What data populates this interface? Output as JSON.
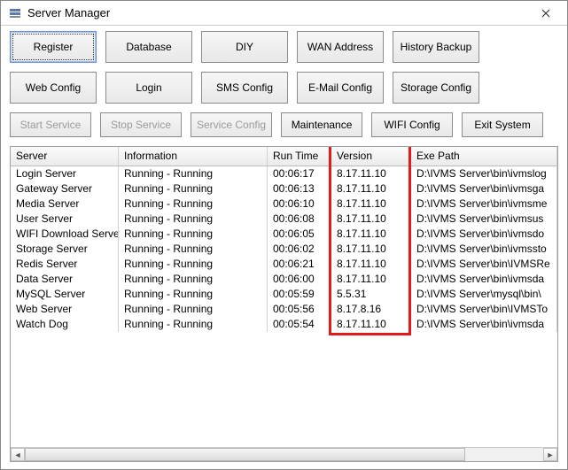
{
  "window": {
    "title": "Server Manager",
    "icon": "server-manager-icon"
  },
  "toolbar_rows": [
    [
      {
        "key": "register",
        "label": "Register",
        "focused": true,
        "disabled": false
      },
      {
        "key": "database",
        "label": "Database",
        "focused": false,
        "disabled": false
      },
      {
        "key": "diy",
        "label": "DIY",
        "focused": false,
        "disabled": false
      },
      {
        "key": "wan",
        "label": "WAN Address",
        "focused": false,
        "disabled": false
      },
      {
        "key": "history",
        "label": "History Backup",
        "focused": false,
        "disabled": false
      }
    ],
    [
      {
        "key": "webconfig",
        "label": "Web Config",
        "focused": false,
        "disabled": false
      },
      {
        "key": "login",
        "label": "Login",
        "focused": false,
        "disabled": false
      },
      {
        "key": "smsconfig",
        "label": "SMS Config",
        "focused": false,
        "disabled": false
      },
      {
        "key": "emailconfig",
        "label": "E-Mail Config",
        "focused": false,
        "disabled": false
      },
      {
        "key": "storageconfig",
        "label": "Storage Config",
        "focused": false,
        "disabled": false
      }
    ],
    [
      {
        "key": "startservice",
        "label": "Start Service",
        "focused": false,
        "disabled": true,
        "short": true
      },
      {
        "key": "stopservice",
        "label": "Stop Service",
        "focused": false,
        "disabled": true,
        "short": true
      },
      {
        "key": "serviceconfig",
        "label": "Service Config",
        "focused": false,
        "disabled": true,
        "short": true
      },
      {
        "key": "maintenance",
        "label": "Maintenance",
        "focused": false,
        "disabled": false,
        "short": true
      },
      {
        "key": "wificonfig",
        "label": "WIFI Config",
        "focused": false,
        "disabled": false,
        "short": true
      },
      {
        "key": "exitsystem",
        "label": "Exit System",
        "focused": false,
        "disabled": false,
        "short": true
      }
    ]
  ],
  "columns": [
    {
      "key": "server",
      "label": "Server"
    },
    {
      "key": "info",
      "label": "Information"
    },
    {
      "key": "run",
      "label": "Run Time"
    },
    {
      "key": "ver",
      "label": "Version"
    },
    {
      "key": "path",
      "label": "Exe Path"
    }
  ],
  "rows": [
    {
      "server": "Login Server",
      "info": "Running - Running",
      "run": "00:06:17",
      "ver": "8.17.11.10",
      "path": "D:\\IVMS Server\\bin\\ivmslog"
    },
    {
      "server": "Gateway Server",
      "info": "Running - Running",
      "run": "00:06:13",
      "ver": "8.17.11.10",
      "path": "D:\\IVMS Server\\bin\\ivmsga"
    },
    {
      "server": "Media Server",
      "info": "Running - Running",
      "run": "00:06:10",
      "ver": "8.17.11.10",
      "path": "D:\\IVMS Server\\bin\\ivmsme"
    },
    {
      "server": "User Server",
      "info": "Running - Running",
      "run": "00:06:08",
      "ver": "8.17.11.10",
      "path": "D:\\IVMS Server\\bin\\ivmsus"
    },
    {
      "server": "WIFI Download Server",
      "info": "Running - Running",
      "run": "00:06:05",
      "ver": "8.17.11.10",
      "path": "D:\\IVMS Server\\bin\\ivmsdo"
    },
    {
      "server": "Storage Server",
      "info": "Running - Running",
      "run": "00:06:02",
      "ver": "8.17.11.10",
      "path": "D:\\IVMS Server\\bin\\ivmssto"
    },
    {
      "server": "Redis Server",
      "info": "Running - Running",
      "run": "00:06:21",
      "ver": "8.17.11.10",
      "path": "D:\\IVMS Server\\bin\\IVMSRe"
    },
    {
      "server": "Data Server",
      "info": "Running - Running",
      "run": "00:06:00",
      "ver": "8.17.11.10",
      "path": "D:\\IVMS Server\\bin\\ivmsda"
    },
    {
      "server": "MySQL Server",
      "info": "Running - Running",
      "run": "00:05:59",
      "ver": "5.5.31",
      "path": "D:\\IVMS Server\\mysql\\bin\\"
    },
    {
      "server": "Web Server",
      "info": "Running - Running",
      "run": "00:05:56",
      "ver": "8.17.8.16",
      "path": "D:\\IVMS Server\\bin\\IVMSTo"
    },
    {
      "server": "Watch Dog",
      "info": "Running - Running",
      "run": "00:05:54",
      "ver": "8.17.11.10",
      "path": "D:\\IVMS Server\\bin\\ivmsda"
    }
  ],
  "highlight": {
    "column": "ver"
  }
}
